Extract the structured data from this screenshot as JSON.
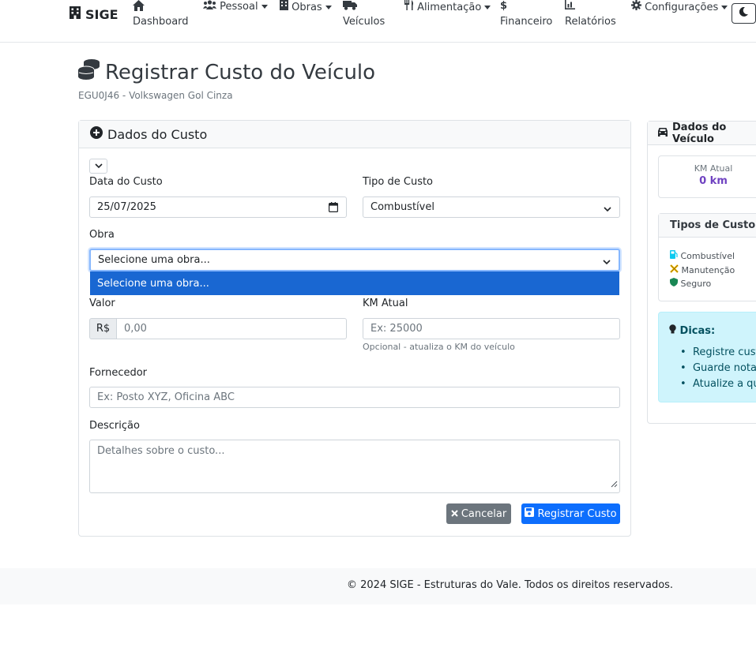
{
  "nav": {
    "brand": "SIGE",
    "items": {
      "dashboard": "Dashboard",
      "pessoal": "Pessoal",
      "obras": "Obras",
      "veiculos": "Veículos",
      "alimentacao": "Alimentação",
      "financeiro": "Financeiro",
      "relatorios": "Relatórios",
      "configuracoes": "Configurações"
    }
  },
  "page": {
    "title": "Registrar Custo do Veículo",
    "subtitle": "EGU0J46 - Volkswagen Gol Cinza"
  },
  "form": {
    "card_title": "Dados do Custo",
    "data_label": "Data do Custo",
    "data_value": "25/07/2025",
    "tipo_label": "Tipo de Custo",
    "tipo_value": "Combustível",
    "obra_label": "Obra",
    "obra_value": "Selecione uma obra...",
    "obra_options": [
      "Selecione uma obra..."
    ],
    "valor_label": "Valor",
    "valor_prefix": "R$",
    "valor_placeholder": "0,00",
    "km_label": "KM Atual",
    "km_placeholder": "Ex: 25000",
    "km_help": "Opcional - atualiza o KM do veículo",
    "fornecedor_label": "Fornecedor",
    "fornecedor_placeholder": "Ex: Posto XYZ, Oficina ABC",
    "descricao_label": "Descrição",
    "descricao_placeholder": "Detalhes sobre o custo...",
    "cancel_label": "Cancelar",
    "submit_label": "Registrar Custo"
  },
  "sidebar": {
    "title": "Dados do Veículo",
    "km_label": "KM Atual",
    "km_value": "0 km",
    "tipos_title": "Tipos de Custo",
    "tipos": [
      "Combustível",
      "Manutenção",
      "Seguro"
    ],
    "dicas_title": "Dicas:",
    "dicas": [
      "Registre custo",
      "Guarde notas",
      "Atualize a quil"
    ]
  },
  "footer": {
    "text": "© 2024 SIGE - Estruturas do Vale. Todos os direitos reservados."
  },
  "colors": {
    "primary": "#0d6efd",
    "secondary": "#6c757d",
    "dropdown_highlight": "#1967d2",
    "km_value": "#6f42c1",
    "info_bg": "#cff4fc",
    "fuel": "#0dcaf0",
    "maintenance": "#ffc107",
    "insurance": "#198754"
  }
}
